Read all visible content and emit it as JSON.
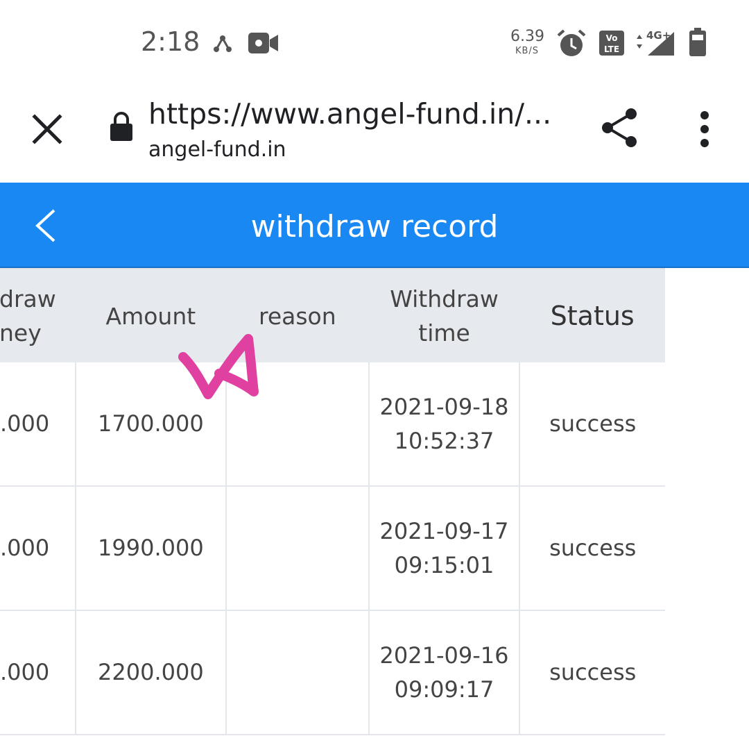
{
  "status_bar": {
    "time": "2:18",
    "net_speed_value": "6.39",
    "net_speed_unit": "KB/S",
    "icons": [
      "hotspot-icon",
      "video-record-icon",
      "alarm-icon",
      "volte-icon",
      "4g-data-icon",
      "signal-icon",
      "battery-icon"
    ]
  },
  "browser": {
    "url": "https://www.angel-fund.in/...",
    "domain": "angel-fund.in",
    "icons": [
      "close-icon",
      "lock-icon",
      "share-icon",
      "more-vert-icon"
    ]
  },
  "header": {
    "title": "withdraw record",
    "accent_color": "#1a88f3"
  },
  "table": {
    "columns": [
      "draw\nney",
      "Amount",
      "reason",
      "Withdraw\ntime",
      "Status"
    ],
    "rows": [
      {
        "money": ".000",
        "amount": "1700.000",
        "reason": "",
        "time": "2021-09-18\n10:52:37",
        "status": "success"
      },
      {
        "money": ".000",
        "amount": "1990.000",
        "reason": "",
        "time": "2021-09-17\n09:15:01",
        "status": "success"
      },
      {
        "money": ".000",
        "amount": "2200.000",
        "reason": "",
        "time": "2021-09-16\n09:09:17",
        "status": "success"
      }
    ]
  },
  "annotation": {
    "shape": "pink-check-mark",
    "color": "#e040a0"
  }
}
